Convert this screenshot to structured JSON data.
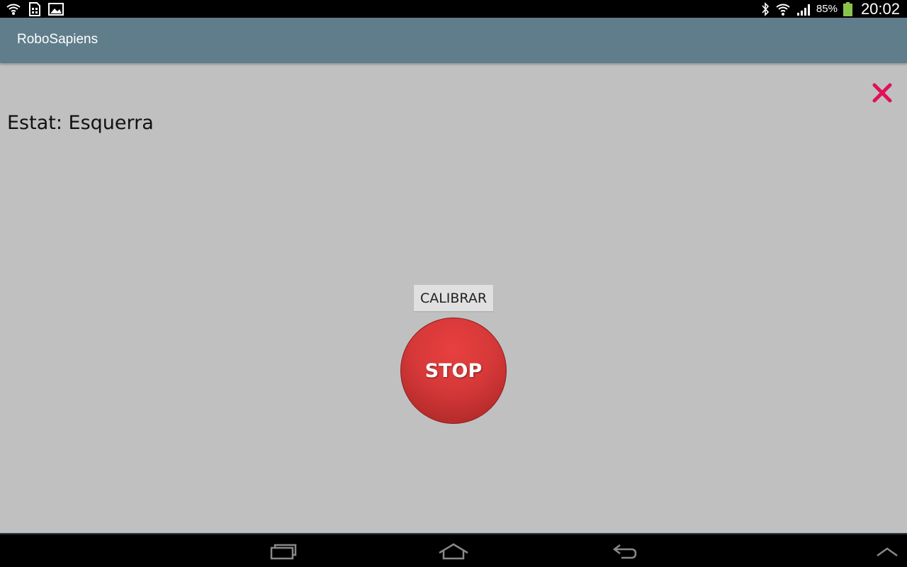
{
  "status_bar": {
    "left_icons": [
      "wifi-signal-icon",
      "sim-card-icon",
      "gallery-icon"
    ],
    "right_icons": [
      "bluetooth-icon",
      "wifi-icon",
      "cell-signal-icon"
    ],
    "battery_percent": "85%",
    "battery_level": 0.85,
    "time": "20:02"
  },
  "action_bar": {
    "title": "RoboSapiens",
    "background_color": "#607d8b"
  },
  "content": {
    "close_icon": "close-icon",
    "close_color": "#e0105a",
    "status_text": "Estat: Esquerra",
    "calibrate_label": "CALIBRAR",
    "stop_label": "STOP",
    "stop_color": "#d63838"
  },
  "nav_bar": {
    "buttons": [
      "recent-apps-icon",
      "home-icon",
      "back-icon",
      "up-chevron-icon"
    ]
  }
}
